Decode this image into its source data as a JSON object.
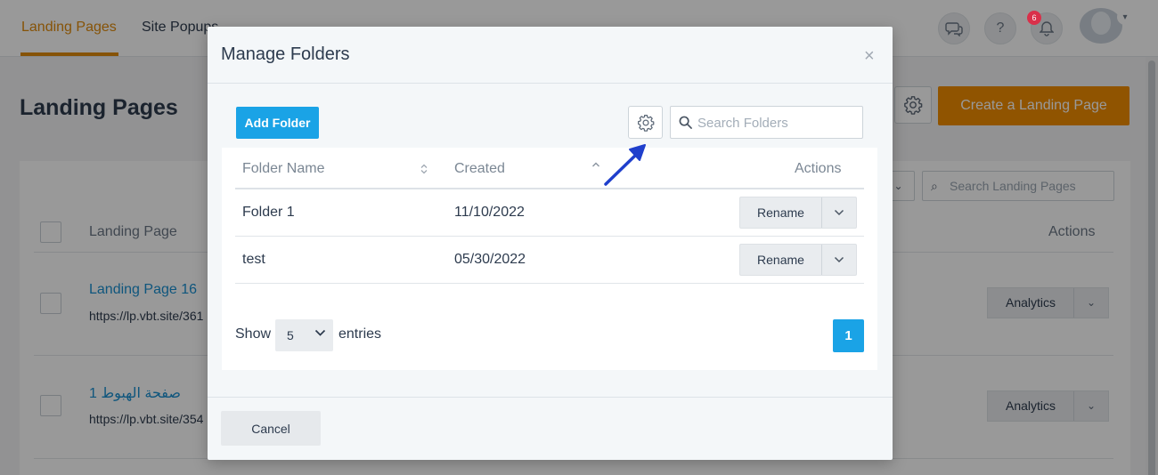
{
  "topbar": {
    "tabs": [
      {
        "label": "Landing Pages",
        "active": true
      },
      {
        "label": "Site Popups",
        "active": false
      }
    ],
    "notification_count": "6",
    "help_label": "?"
  },
  "background": {
    "page_title": "Landing Pages",
    "create_button": "Create a Landing Page",
    "search_placeholder": "Search Landing Pages",
    "columns": [
      "Landing Page",
      "Actions"
    ],
    "rows": [
      {
        "title": "Landing Page 16",
        "url": "https://lp.vbt.site/361",
        "action": "Analytics"
      },
      {
        "title": "صفحة الهبوط 1",
        "url": "https://lp.vbt.site/354",
        "action": "Analytics"
      }
    ]
  },
  "modal": {
    "title": "Manage Folders",
    "add_folder_label": "Add Folder",
    "search_placeholder": "Search Folders",
    "columns": {
      "name": "Folder Name",
      "created": "Created",
      "actions": "Actions"
    },
    "rows": [
      {
        "name": "Folder 1",
        "created": "11/10/2022",
        "action": "Rename"
      },
      {
        "name": "test",
        "created": "05/30/2022",
        "action": "Rename"
      }
    ],
    "pagination": {
      "show_label": "Show",
      "entries_value": "5",
      "entries_label": "entries",
      "current_page": "1"
    },
    "cancel_label": "Cancel"
  },
  "colors": {
    "accent_orange": "#f08c00",
    "primary_blue": "#1aa3e6",
    "link_blue": "#1a8fd1",
    "annotation_arrow": "#1f3fcc"
  }
}
